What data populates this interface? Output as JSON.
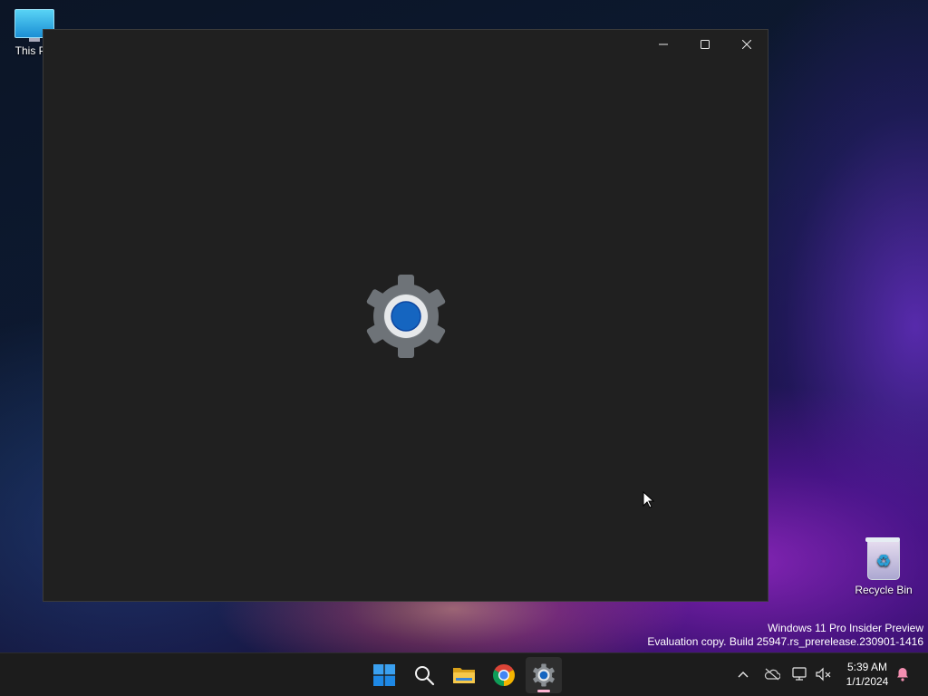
{
  "desktop": {
    "icons": [
      {
        "label": "This PC"
      },
      {
        "label": "Recycle Bin"
      }
    ]
  },
  "window": {
    "app": "Settings",
    "state": "loading-splash",
    "controls": {
      "minimize": "minimize-icon",
      "maximize": "maximize-icon",
      "close": "close-icon"
    }
  },
  "watermark": {
    "line1": "Windows 11 Pro Insider Preview",
    "line2": "Evaluation copy. Build 25947.rs_prerelease.230901-1416"
  },
  "taskbar": {
    "apps": [
      "start-icon",
      "search-icon",
      "file-explorer-icon",
      "chrome-icon",
      "settings-icon"
    ],
    "active_app": "settings-icon",
    "tray": [
      "chevron-up-icon",
      "onedrive-icon",
      "network-icon",
      "speaker-muted-icon"
    ],
    "time": "5:39 AM",
    "date": "1/1/2024"
  },
  "colors": {
    "settings_gear": "#6e7378",
    "settings_core": "#1565c0",
    "window_bg": "#202020",
    "taskbar_bg": "#1c1c1c"
  }
}
